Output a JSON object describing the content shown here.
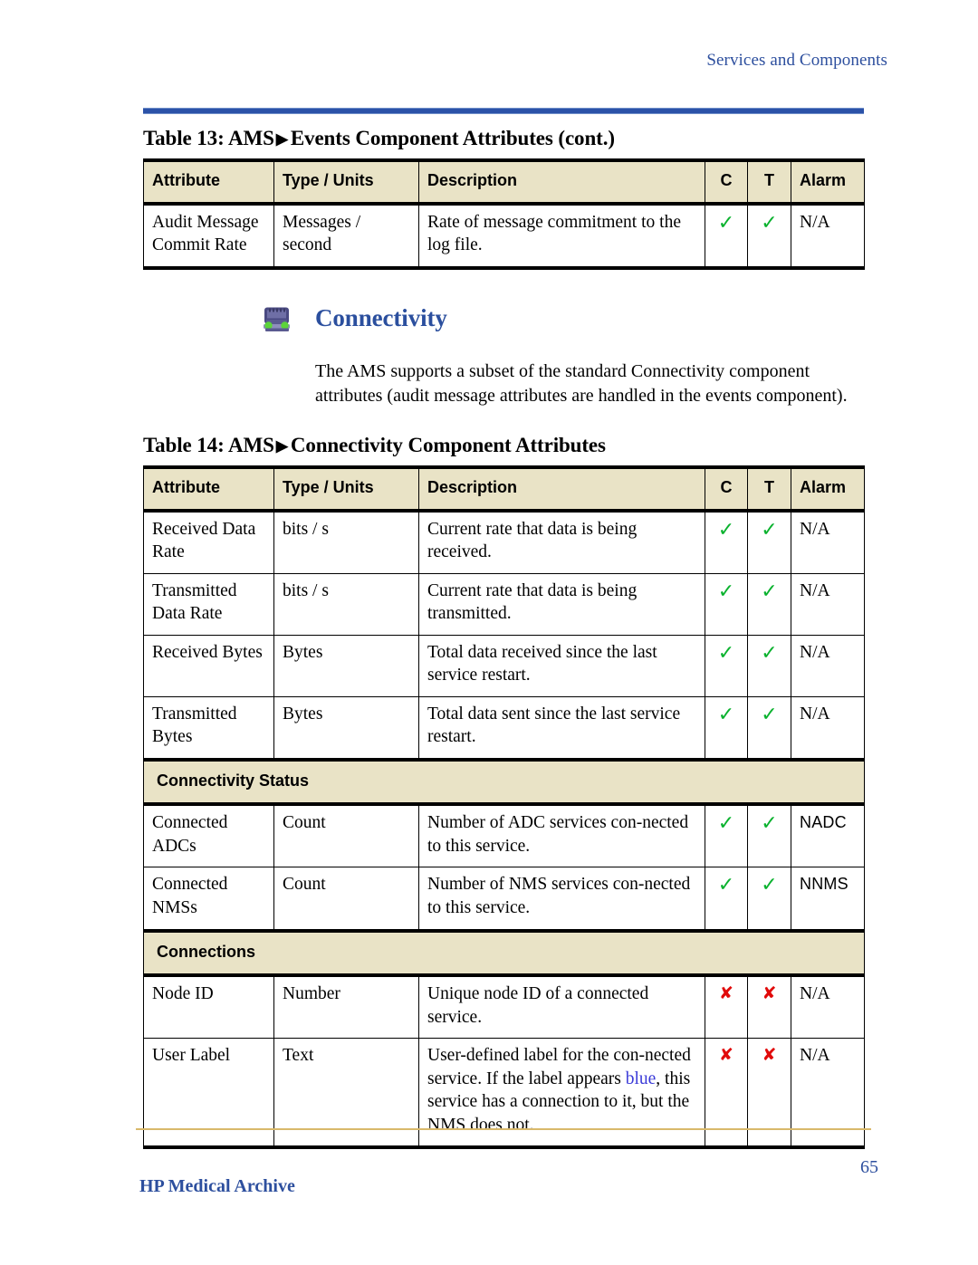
{
  "header": {
    "running_head": "Services and Components",
    "rule_color": "#2b52a8"
  },
  "table13": {
    "caption_prefix": "Table 13: AMS",
    "caption_triangle": "▶",
    "caption_suffix": "Events Component Attributes (cont.)",
    "columns": [
      "Attribute",
      "Type / Units",
      "Description",
      "C",
      "T",
      "Alarm"
    ],
    "rows": [
      {
        "attribute": "Audit Message Commit Rate",
        "type": "Messages / second",
        "description": "Rate of message commitment to the log file.",
        "c": "✓",
        "t": "✓",
        "alarm": "N/A"
      }
    ]
  },
  "connectivity_section": {
    "icon": "network-port-icon",
    "heading": "Connectivity",
    "paragraph": "The AMS supports a subset of the standard Connectivity component attributes (audit message attributes are handled in the events component)."
  },
  "table14": {
    "caption_prefix": "Table 14: AMS",
    "caption_triangle": "▶",
    "caption_suffix": "Connectivity Component Attributes",
    "columns": [
      "Attribute",
      "Type / Units",
      "Description",
      "C",
      "T",
      "Alarm"
    ],
    "rows": [
      {
        "kind": "data",
        "attribute": "Received Data Rate",
        "type": "bits / s",
        "description": "Current rate that data is being received.",
        "c": "✓",
        "t": "✓",
        "alarm": "N/A"
      },
      {
        "kind": "data",
        "attribute": "Transmitted Data Rate",
        "type": "bits / s",
        "description": "Current rate that data is being transmitted.",
        "c": "✓",
        "t": "✓",
        "alarm": "N/A"
      },
      {
        "kind": "data",
        "attribute": "Received Bytes",
        "type": "Bytes",
        "description": "Total data received since the last service restart.",
        "c": "✓",
        "t": "✓",
        "alarm": "N/A"
      },
      {
        "kind": "data",
        "attribute": "Transmitted Bytes",
        "type": "Bytes",
        "description": "Total data sent since the last service restart.",
        "c": "✓",
        "t": "✓",
        "alarm": "N/A"
      },
      {
        "kind": "section",
        "label": "Connectivity Status"
      },
      {
        "kind": "data",
        "attribute": "Connected ADCs",
        "type": "Count",
        "description": "Number of ADC services con-nected to this service.",
        "c": "✓",
        "t": "✓",
        "alarm": "NADC"
      },
      {
        "kind": "data",
        "attribute": "Connected NMSs",
        "type": "Count",
        "description": "Number of NMS services con-nected to this service.",
        "c": "✓",
        "t": "✓",
        "alarm": "NNMS"
      },
      {
        "kind": "section",
        "label": "Connections"
      },
      {
        "kind": "data",
        "attribute": "Node ID",
        "type": "Number",
        "description": "Unique node ID of a connected service.",
        "c": "✘",
        "t": "✘",
        "alarm": "N/A"
      },
      {
        "kind": "data",
        "attribute": "User Label",
        "type": "Text",
        "description_part1": "User-defined label for the con-nected service. If the label appears ",
        "description_blue": "blue",
        "description_part2": ", this service has a connection to it, but the NMS does not.",
        "c": "✘",
        "t": "✘",
        "alarm": "N/A"
      }
    ]
  },
  "footer": {
    "product": "HP Medical Archive",
    "page_number": "65",
    "rule_color": "#d9b96b",
    "text_color": "#2d4f9e"
  },
  "colors": {
    "header_fill": "#e9e3c6",
    "check_green": "#0ab22e",
    "cross_red": "#e10a0a",
    "heading_blue": "#2b4f9e",
    "inline_blue": "#3a3ad8"
  }
}
